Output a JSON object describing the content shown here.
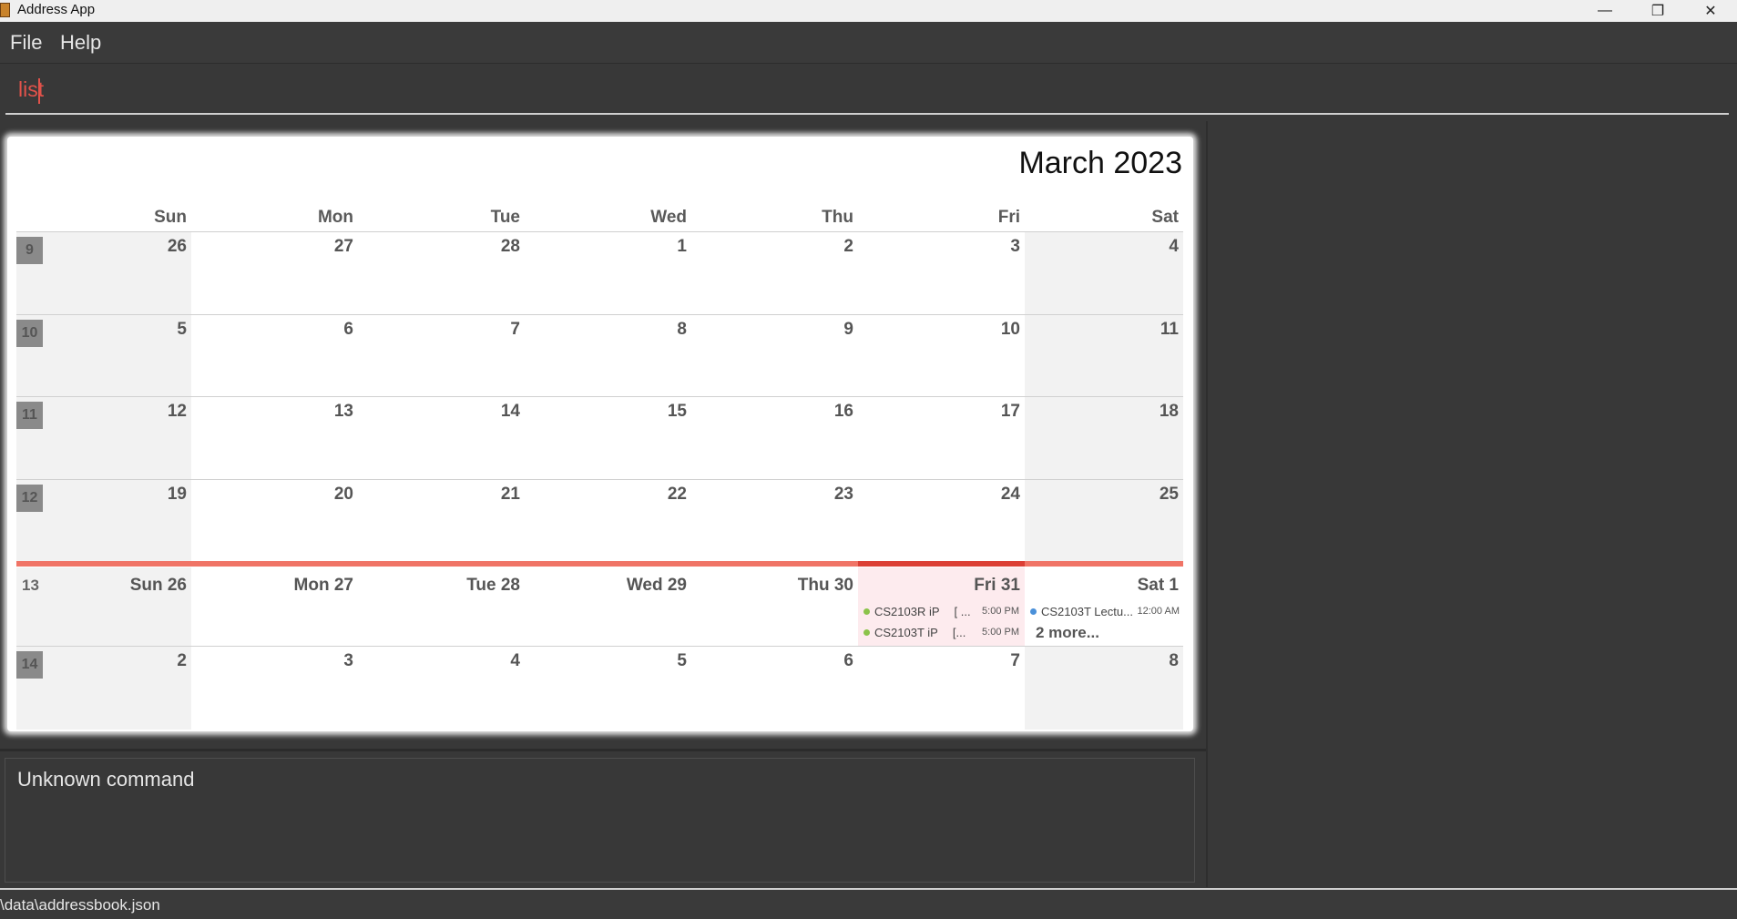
{
  "window": {
    "title": "Address App",
    "minimize_glyph": "—",
    "maximize_glyph": "❐",
    "close_glyph": "✕"
  },
  "menu": {
    "items": [
      "File",
      "Help"
    ]
  },
  "command": {
    "value": "list",
    "accent": "#e0524a"
  },
  "calendar": {
    "title": "March 2023",
    "days_of_week": [
      "Sun",
      "Mon",
      "Tue",
      "Wed",
      "Thu",
      "Fri",
      "Sat"
    ],
    "weeks": [
      {
        "week": "9",
        "days": [
          "26",
          "27",
          "28",
          "1",
          "2",
          "3",
          "4"
        ]
      },
      {
        "week": "10",
        "days": [
          "5",
          "6",
          "7",
          "8",
          "9",
          "10",
          "11"
        ]
      },
      {
        "week": "11",
        "days": [
          "12",
          "13",
          "14",
          "15",
          "16",
          "17",
          "18"
        ]
      },
      {
        "week": "12",
        "days": [
          "19",
          "20",
          "21",
          "22",
          "23",
          "24",
          "25"
        ]
      },
      {
        "week": "13",
        "current": true,
        "today_index": 5,
        "days": [
          "Sun 26",
          "Mon 27",
          "Tue 28",
          "Wed 29",
          "Thu 30",
          "Fri 31",
          "Sat 1"
        ]
      },
      {
        "week": "14",
        "days": [
          "2",
          "3",
          "4",
          "5",
          "6",
          "7",
          "8"
        ]
      }
    ],
    "events": [
      {
        "title": "CS2103R iP",
        "extra": "[ ...",
        "time": "5:00 PM",
        "color": "#8bc34a"
      },
      {
        "title": "CS2103T iP",
        "extra": "[...",
        "time": "5:00 PM",
        "color": "#8bc34a"
      },
      {
        "title": "CS2103T Lectu...",
        "extra": "",
        "time": "12:00 AM",
        "color": "#4a90d9"
      }
    ],
    "more_label": "2 more...",
    "current_week_color": "#f07466",
    "today_color": "#dc3f35"
  },
  "result": {
    "message": "Unknown command"
  },
  "status": {
    "path": "\\data\\addressbook.json"
  }
}
